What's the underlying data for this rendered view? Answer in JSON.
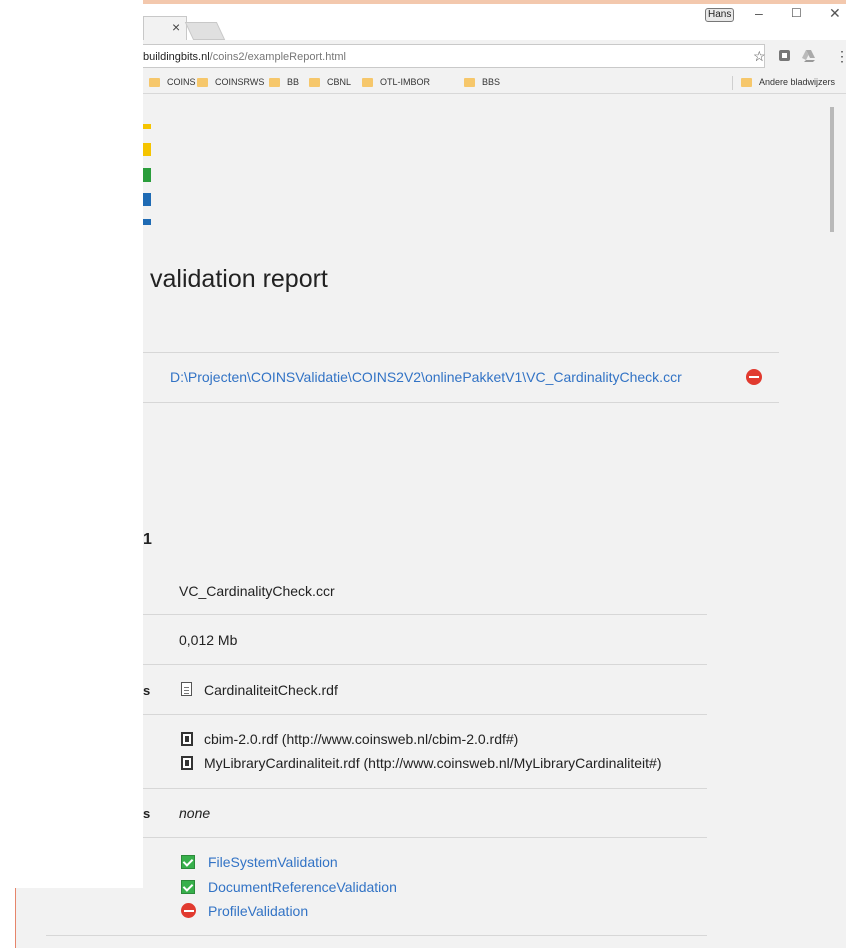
{
  "browser": {
    "profile_name": "Hans",
    "url_domain": "buildingbits.nl",
    "url_path": "/coins2/exampleReport.html",
    "bookmarks": [
      {
        "label": "COINS"
      },
      {
        "label": "COINSRWS"
      },
      {
        "label": "BB"
      },
      {
        "label": "CBNL"
      },
      {
        "label": "OTL-IMBOR"
      },
      {
        "label": "BBS"
      }
    ],
    "other_bookmarks": "Andere bladwijzers",
    "tab_close_glyph": "×",
    "window_controls": [
      "–",
      "☐",
      "✕"
    ],
    "star_glyph": "☆",
    "menu_glyph": "⋮"
  },
  "logo_colors": [
    "#f5c400",
    "#f5c400",
    "#f5c400",
    "#2a9d3b",
    "#1f6bb4",
    "#1f6bb4"
  ],
  "report": {
    "title": "validation report",
    "container_path": "D:\\Projecten\\COINSValidatie\\COINS2V2\\onlinePakketV1\\VC_CardinalityCheck.ccr",
    "section_heading_fragment": "1",
    "file_name": "VC_CardinalityCheck.ccr",
    "file_size": "0,012 Mb",
    "content_label_fragment": "s",
    "content_file": "CardinaliteitCheck.rdf",
    "libraries": [
      "cbim-2.0.rdf (http://www.coinsweb.nl/cbim-2.0.rdf#)",
      "MyLibraryCardinaliteit.rdf (http://www.coinsweb.nl/MyLibraryCardinaliteit#)"
    ],
    "attachments_label_fragment": "s",
    "attachments": "none",
    "validations": [
      {
        "name": "FileSystemValidation",
        "status": "pass"
      },
      {
        "name": "DocumentReferenceValidation",
        "status": "pass"
      },
      {
        "name": "ProfileValidation",
        "status": "fail"
      }
    ]
  }
}
